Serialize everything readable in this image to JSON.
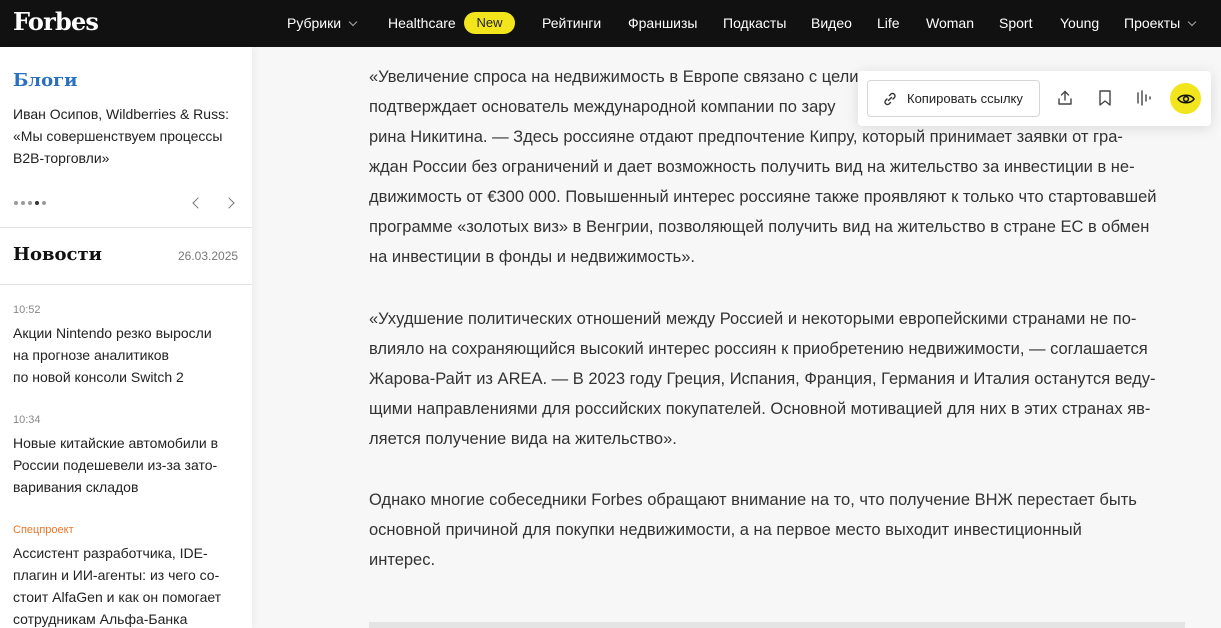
{
  "header": {
    "logo": "Forbes",
    "nav": [
      {
        "label": "Рубрики",
        "dropdown": true
      },
      {
        "label": "Healthcare"
      },
      {
        "label": "Рейтинги"
      },
      {
        "label": "Франшизы"
      },
      {
        "label": "Подкасты"
      },
      {
        "label": "Видео"
      },
      {
        "label": "Life"
      },
      {
        "label": "Woman"
      },
      {
        "label": "Sport"
      },
      {
        "label": "Young"
      },
      {
        "label": "Проекты",
        "dropdown": true
      }
    ],
    "badge": "New"
  },
  "sidebar": {
    "blogs": {
      "title": "Блоги",
      "text_lines": [
        "Иван Осипов, Wildberries & Russ:",
        "«Мы совершенствуем процессы",
        "B2B-торговли»"
      ],
      "slides_count": 5,
      "active_slide": 4
    },
    "news": {
      "title": "Новости",
      "date": "26.03.2025",
      "items": [
        {
          "meta": "10:52",
          "lines": [
            "Акции Nintendo резко выросли",
            "на прогнозе аналитиков",
            "по новой консоли Switch 2"
          ]
        },
        {
          "meta": "10:34",
          "lines": [
            "Новые китайские автомобили в",
            "России подешевели из-за зато-",
            "варивания складов"
          ]
        },
        {
          "meta": "Спецпроект",
          "special": true,
          "lines": [
            "Ассистент разработчика, IDE-",
            "плагин и ИИ-агенты: из чего со-",
            "стоит AlfaGen и как он помогает",
            "сотрудникам Альфа-Банка"
          ]
        }
      ]
    }
  },
  "article": {
    "paragraphs": [
      [
        "«Увеличение спроса на недвижимость в Европе связано с цели",
        "подтверждает основатель международной компании по зару",
        "рина Никитина. — Здесь россияне отдают предпочтение Кипру, который принимает заявки от гра-",
        "ждан России без ограничений и дает возможность получить вид на жительство за инвестиции в не-",
        "движимость от €300 000. Повышенный интерес россияне также проявляют к только что стартовавшей",
        "программе «золотых виз» в Венгрии, позволяющей получить вид на жительство в стране ЕС в обмен",
        "на инвестиции в фонды и недвижимость»."
      ],
      [
        "«Ухудшение политических отношений между Россией и некоторыми европейскими странами не по-",
        "влияло на сохраняющийся высокий интерес россиян к приобретению недвижимости, — соглашается",
        "Жарова-Райт из AREA. — В 2023 году Греция, Испания, Франция, Германия и Италия останутся веду-",
        "щими направлениями для российских покупателей. Основной мотивацией для них в этих странах яв-",
        "ляется получение вида на жительство»."
      ],
      [
        "Однако многие собеседники Forbes обращают внимание на то, что получение ВНЖ перестает быть",
        "основной причиной для покупки недвижимости, а на первое место выходит инвестиционный",
        "интерес."
      ]
    ]
  },
  "toolbar": {
    "copy_label": "Копировать ссылку",
    "icons": [
      "link-icon",
      "share-icon",
      "bookmark-icon",
      "audio-icon",
      "eye-icon"
    ],
    "accent": "#f2e51c"
  },
  "colors": {
    "nav_bg": "#111111",
    "blog_title": "#2b6fbf",
    "special_meta": "#e5772b",
    "badge": "#f2e51c"
  }
}
